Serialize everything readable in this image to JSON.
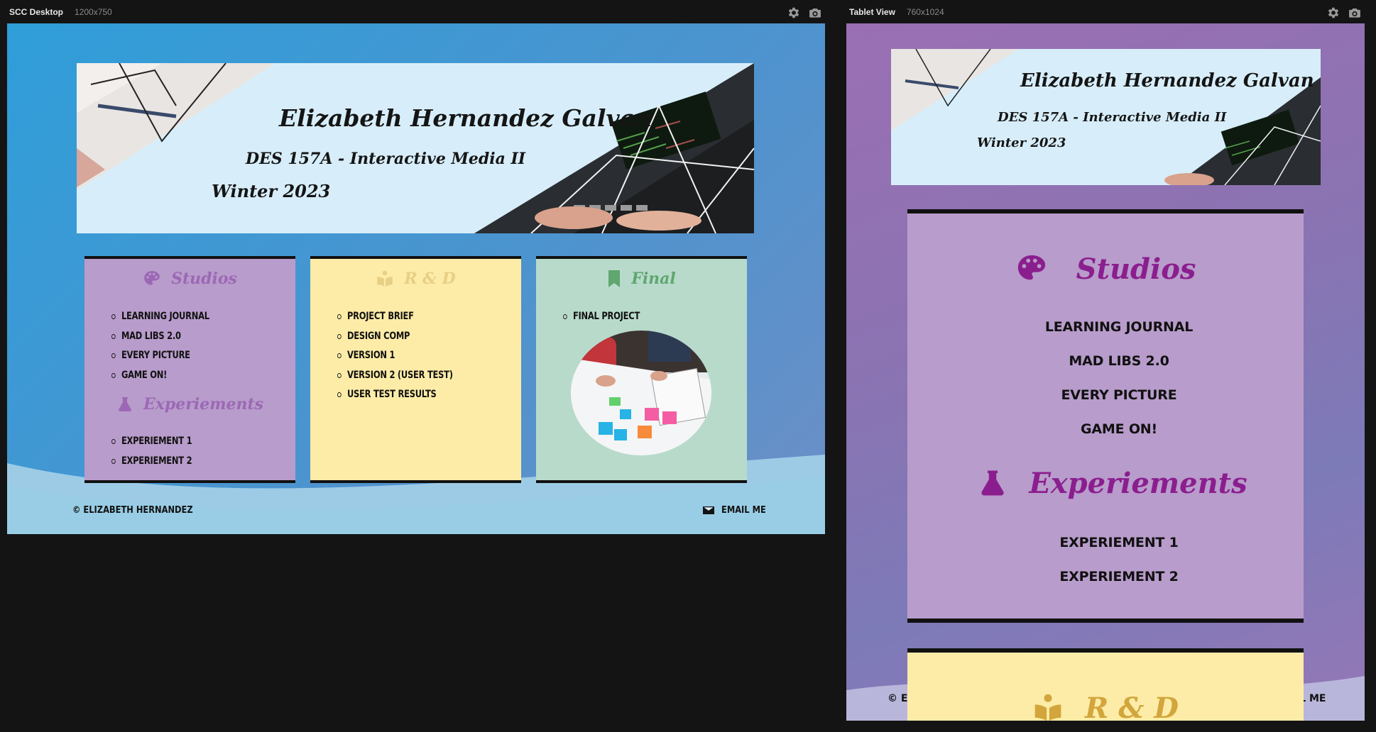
{
  "desktop": {
    "label": "SCC Desktop",
    "dims": "1200x750",
    "banner": {
      "name": "Elizabeth Hernandez Galvan",
      "course": "DES 157A - Interactive Media II",
      "term": "Winter 2023"
    },
    "cards": [
      {
        "title": "Studios",
        "icon": "palette-icon",
        "items": [
          "LEARNING JOURNAL",
          "MAD LIBS 2.0",
          "EVERY PICTURE",
          "GAME ON!"
        ],
        "subtitle": "Experiements",
        "subicon": "flask-icon",
        "subitems": [
          "EXPERIEMENT 1",
          "EXPERIEMENT 2"
        ]
      },
      {
        "title": "R & D",
        "icon": "book-reader-icon",
        "items": [
          "PROJECT BRIEF",
          "DESIGN COMP",
          "VERSION 1",
          "VERSION 2 (USER TEST)",
          "USER TEST RESULTS"
        ]
      },
      {
        "title": "Final",
        "icon": "bookmark-icon",
        "items": [
          "FINAL PROJECT"
        ]
      }
    ],
    "footer": {
      "copyright": "© ELIZABETH HERNANDEZ",
      "email": "EMAIL ME",
      "email_icon": "envelope-icon"
    }
  },
  "tablet": {
    "label": "Tablet View",
    "dims": "760x1024",
    "banner": {
      "name": "Elizabeth Hernandez Galvan",
      "course": "DES 157A - Interactive Media II",
      "term": "Winter 2023"
    },
    "studios": {
      "title": "Studios",
      "items": [
        "LEARNING JOURNAL",
        "MAD LIBS 2.0",
        "EVERY PICTURE",
        "GAME ON!"
      ],
      "subtitle": "Experiements",
      "subitems": [
        "EXPERIEMENT 1",
        "EXPERIEMENT 2"
      ]
    },
    "rd": {
      "title": "R & D"
    },
    "footer": {
      "copyright_visible": "© EL",
      "email_visible": "IL ME"
    }
  },
  "colors": {
    "studios_bg": "#b89ccb",
    "studios_title": "#9c68b5",
    "rd_bg": "#fdeca7",
    "rd_title": "#e8cf86",
    "final_bg": "#b8dacb",
    "final_title": "#5fa66f",
    "tablet_purple": "#8b1e8e",
    "tablet_gold": "#d2a63c"
  }
}
